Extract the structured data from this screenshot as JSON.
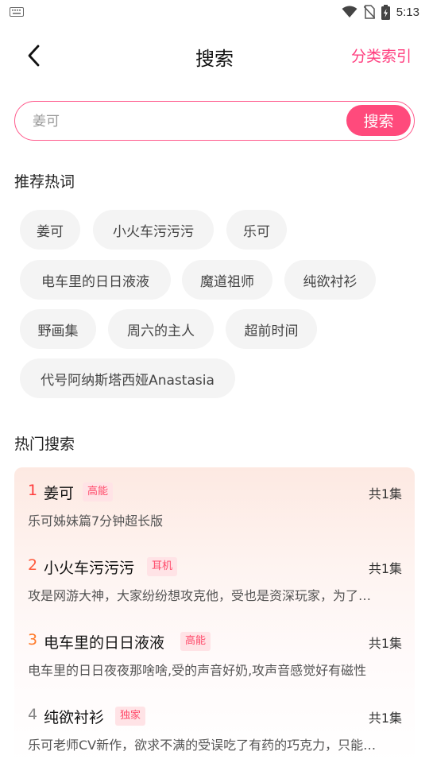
{
  "status_bar": {
    "time": "5:13",
    "icons": [
      "keyboard-icon",
      "wifi-icon",
      "no-sim-icon",
      "battery-charging-icon"
    ]
  },
  "nav": {
    "title": "搜索",
    "category_link": "分类索引",
    "back_icon": "back-arrow-icon"
  },
  "search": {
    "placeholder": "姜可",
    "button_label": "搜索"
  },
  "recommended": {
    "title": "推荐热词",
    "keywords": [
      "姜可",
      "小火车污污污",
      "乐可",
      "电车里的日日液液",
      "魔道祖师",
      "纯欲衬衫",
      "野画集",
      "周六的主人",
      "超前时间",
      "代号阿纳斯塔西娅Anastasia"
    ]
  },
  "hot_search": {
    "title": "热门搜索",
    "items": [
      {
        "rank": "1",
        "name": "姜可",
        "tag": "高能",
        "count": "共1集",
        "desc": "乐可姊妹篇7分钟超长版"
      },
      {
        "rank": "2",
        "name": "小火车污污污",
        "tag": "耳机",
        "count": "共1集",
        "desc": "攻是网游大神，大家纷纷想攻克他，受也是资深玩家，为了…"
      },
      {
        "rank": "3",
        "name": "电车里的日日液液",
        "tag": "高能",
        "count": "共1集",
        "desc": "电车里的日日夜夜那啥啥,受的声音好奶,攻声音感觉好有磁性"
      },
      {
        "rank": "4",
        "name": "纯欲衬衫",
        "tag": "独家",
        "count": "共1集",
        "desc": "乐可老师CV新作，欲求不满的受误吃了有药的巧克力，只能…"
      }
    ]
  },
  "colors": {
    "accent": "#ff4a7c",
    "rank1": "#ff3b3b",
    "rank2": "#ff5a3c",
    "rank3": "#ff7a2a",
    "rank4": "#888888",
    "tag_bg": "#ffe3e6"
  }
}
